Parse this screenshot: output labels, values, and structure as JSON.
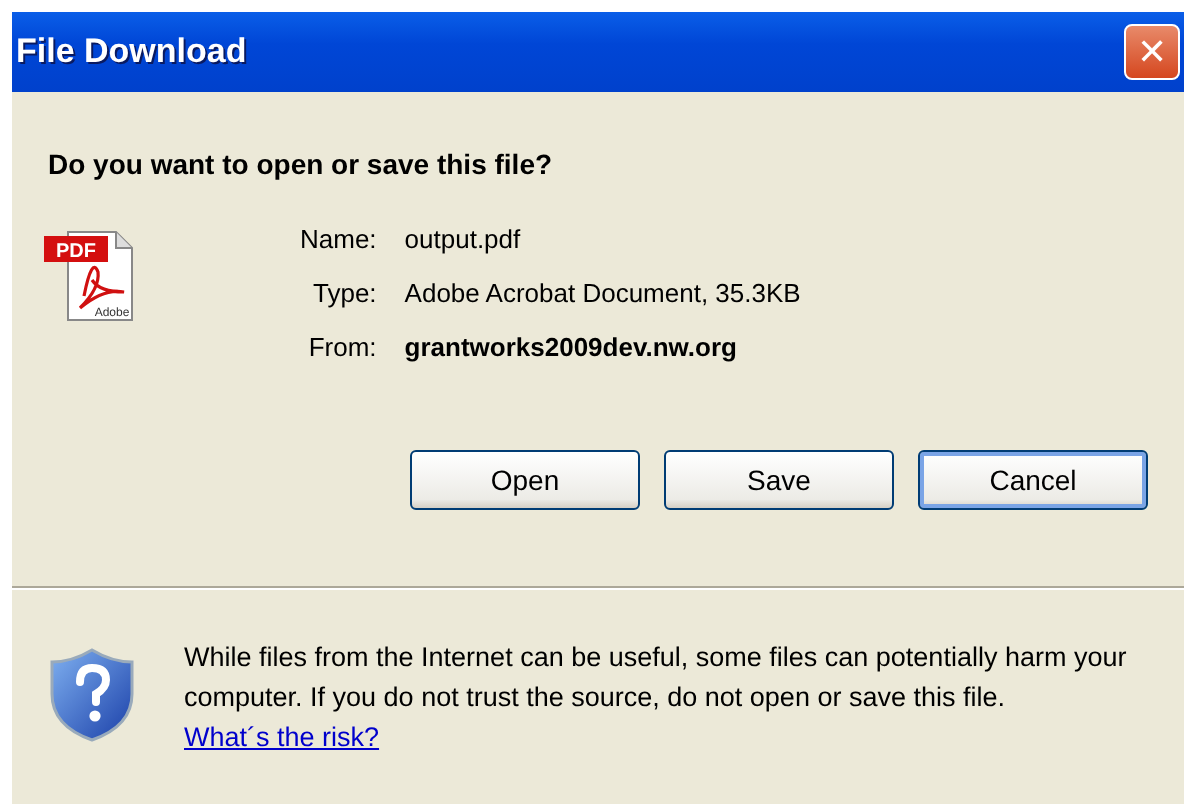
{
  "window": {
    "title": "File Download",
    "close": "✕"
  },
  "question": "Do you want to open or save this file?",
  "fields": [
    {
      "label": "Name:",
      "value": "output.pdf",
      "bold": false
    },
    {
      "label": "Type:",
      "value": "Adobe Acrobat Document, 35.3KB",
      "bold": false
    },
    {
      "label": "From:",
      "value": "grantworks2009dev.nw.org",
      "bold": true
    }
  ],
  "file_icon": {
    "badge": "PDF",
    "caption": "Adobe"
  },
  "buttons": [
    {
      "label": "Open",
      "default": false
    },
    {
      "label": "Save",
      "default": false
    },
    {
      "label": "Cancel",
      "default": true
    }
  ],
  "warning": {
    "text": "While files from the Internet can be useful, some files can potentially harm your computer. If you do not trust the source, do not open or save this file.",
    "link": "What´s the risk?"
  }
}
